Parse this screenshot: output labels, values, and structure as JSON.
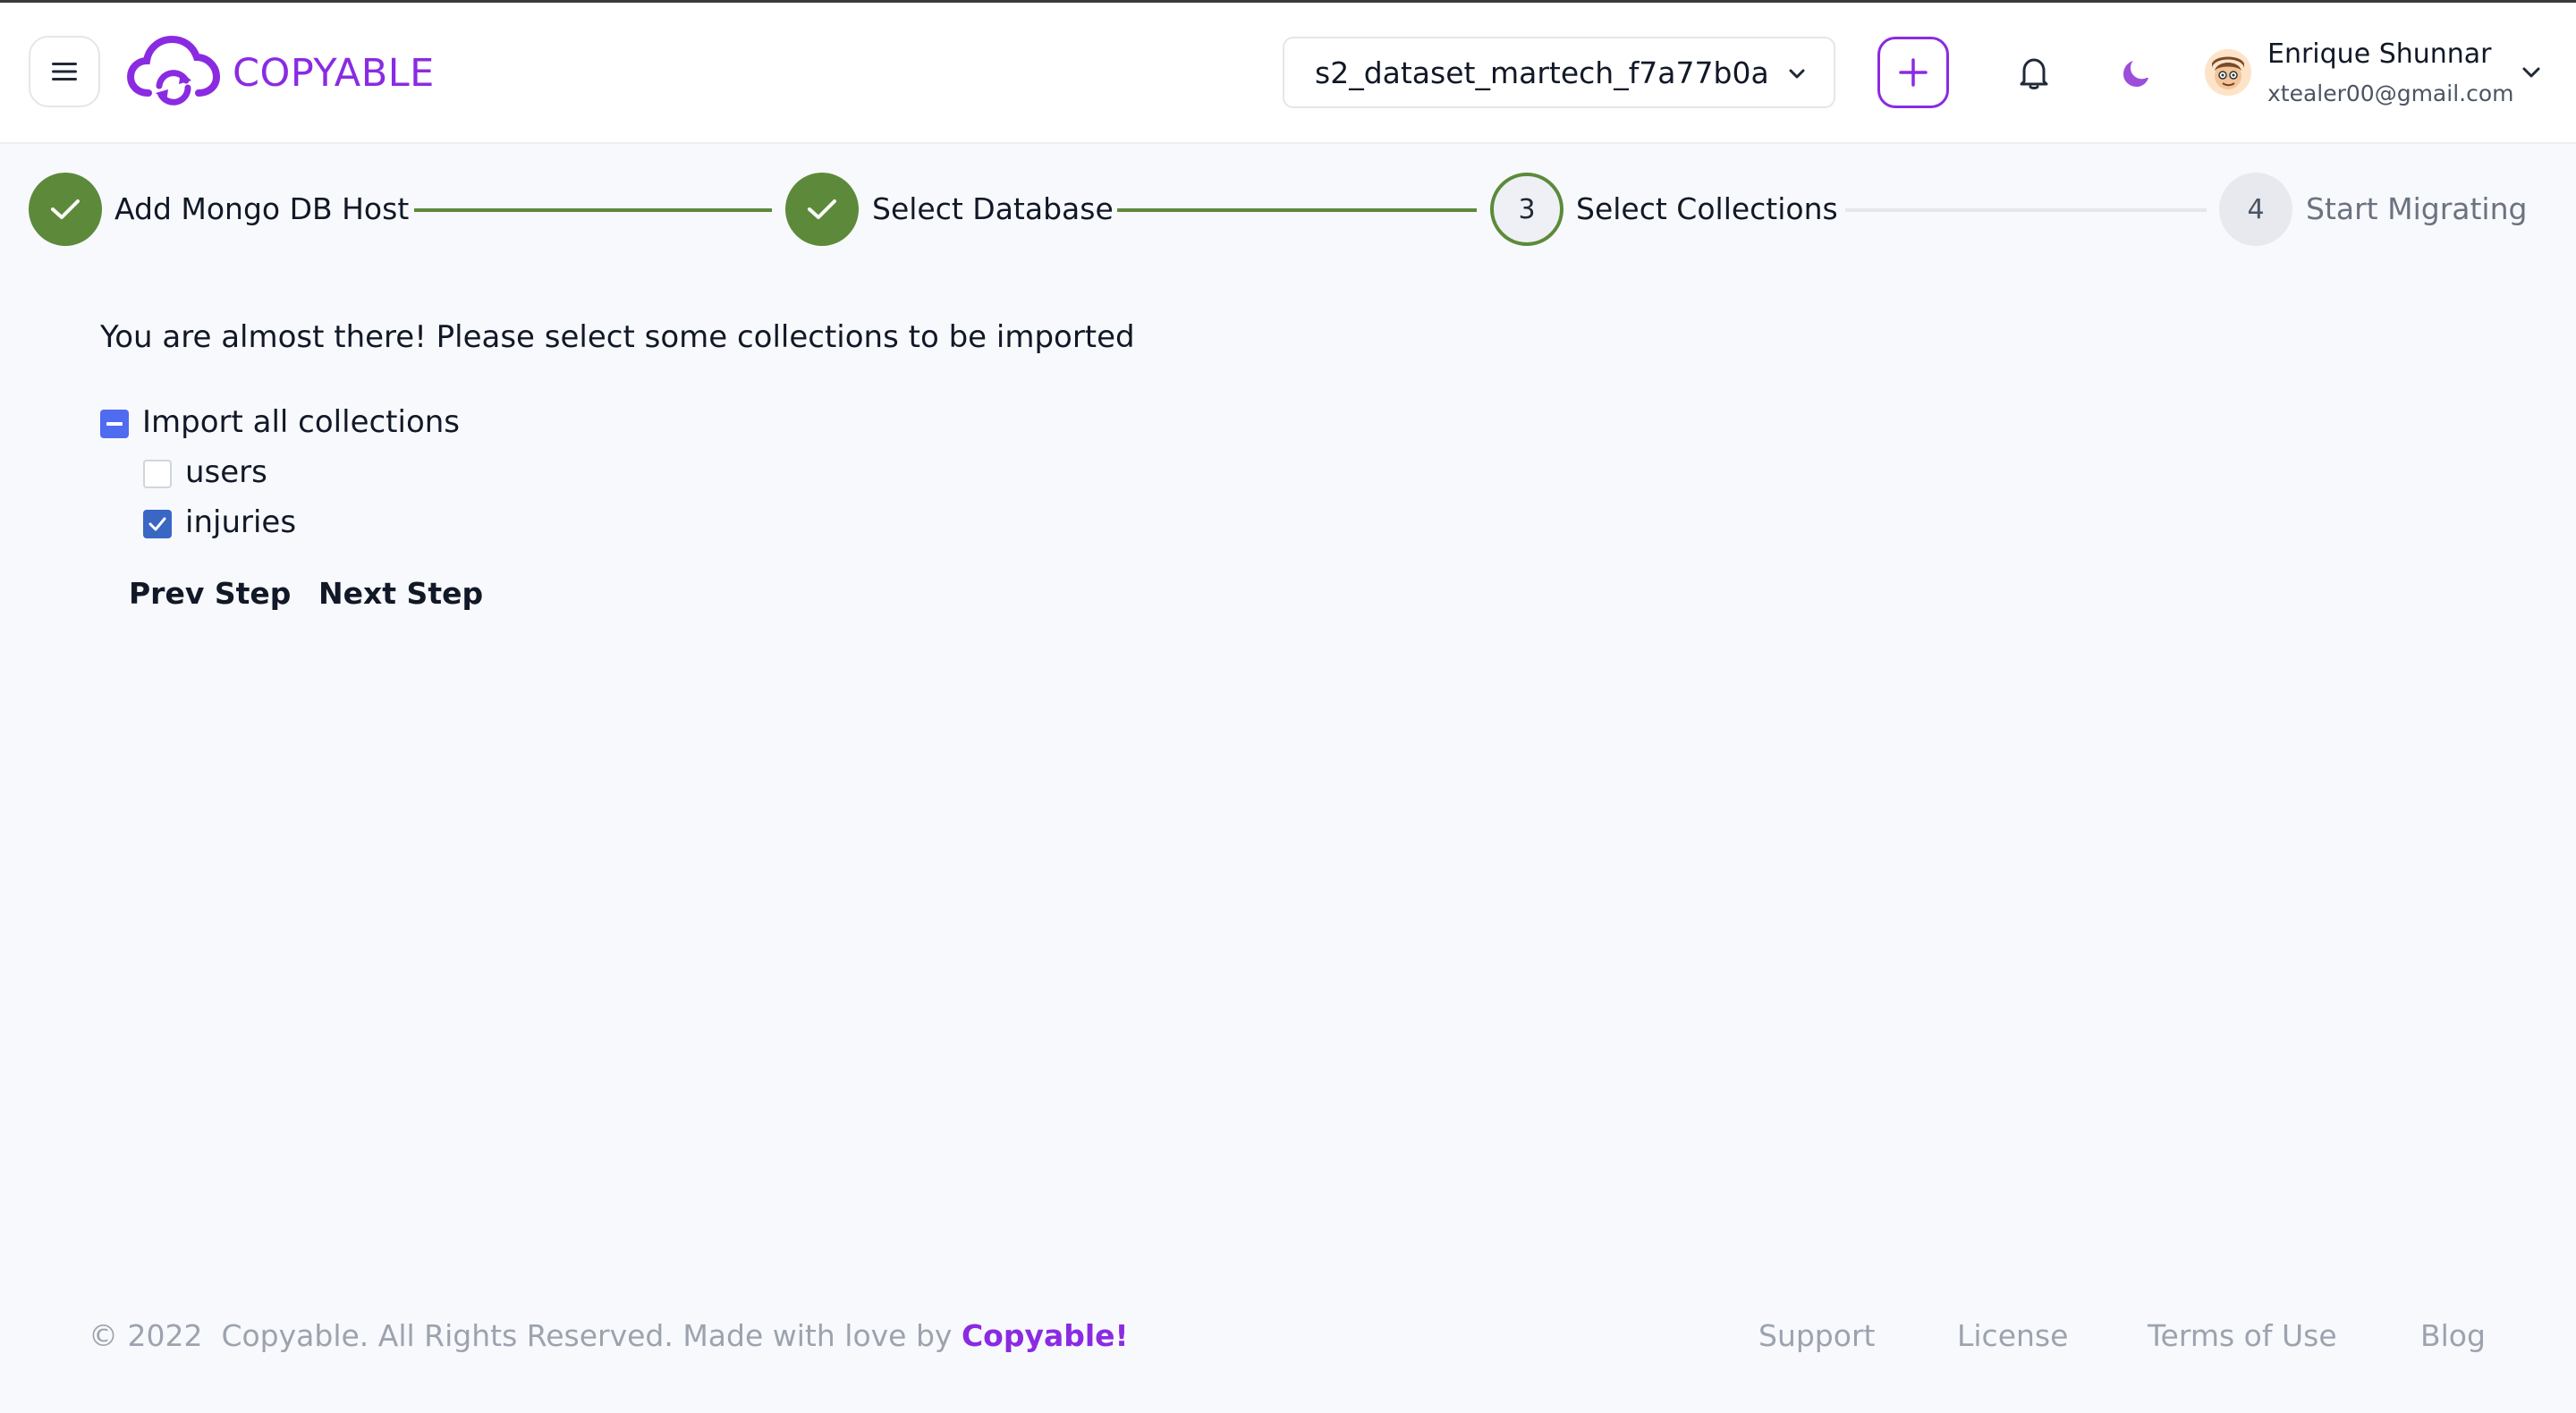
{
  "header": {
    "brand": "COPYABLE",
    "database_select": {
      "value": "s2_dataset_martech_f7a77b0a"
    },
    "user": {
      "name": "Enrique Shunnar",
      "email": "xtealer00@gmail.com"
    }
  },
  "stepper": {
    "steps": [
      {
        "number": "1",
        "label": "Add Mongo DB Host",
        "status": "complete"
      },
      {
        "number": "2",
        "label": "Select Database",
        "status": "complete"
      },
      {
        "number": "3",
        "label": "Select Collections",
        "status": "current"
      },
      {
        "number": "4",
        "label": "Start Migrating",
        "status": "pending"
      }
    ]
  },
  "main": {
    "intro": "You are almost there! Please select some collections to be imported",
    "import_all": {
      "label": "Import all collections",
      "state": "indeterminate"
    },
    "collections": [
      {
        "label": "users",
        "checked": false
      },
      {
        "label": "injuries",
        "checked": true
      }
    ],
    "prev_label": "Prev Step",
    "next_label": "Next Step"
  },
  "footer": {
    "copyright": "© 2022  Copyable. All Rights Reserved. Made with love by",
    "brand": "Copyable!",
    "links": [
      "Support",
      "License",
      "Terms of Use",
      "Blog"
    ]
  },
  "colors": {
    "brand": "#8a2be2",
    "step_complete": "#5c8a3a",
    "checkbox_indeterminate": "#4f6bf0",
    "checkbox_checked": "#3a66c4"
  },
  "icons": [
    "menu-icon",
    "cloud-sync-logo-icon",
    "chevron-down-icon",
    "plus-icon",
    "bell-icon",
    "moon-icon",
    "checkmark-icon"
  ]
}
